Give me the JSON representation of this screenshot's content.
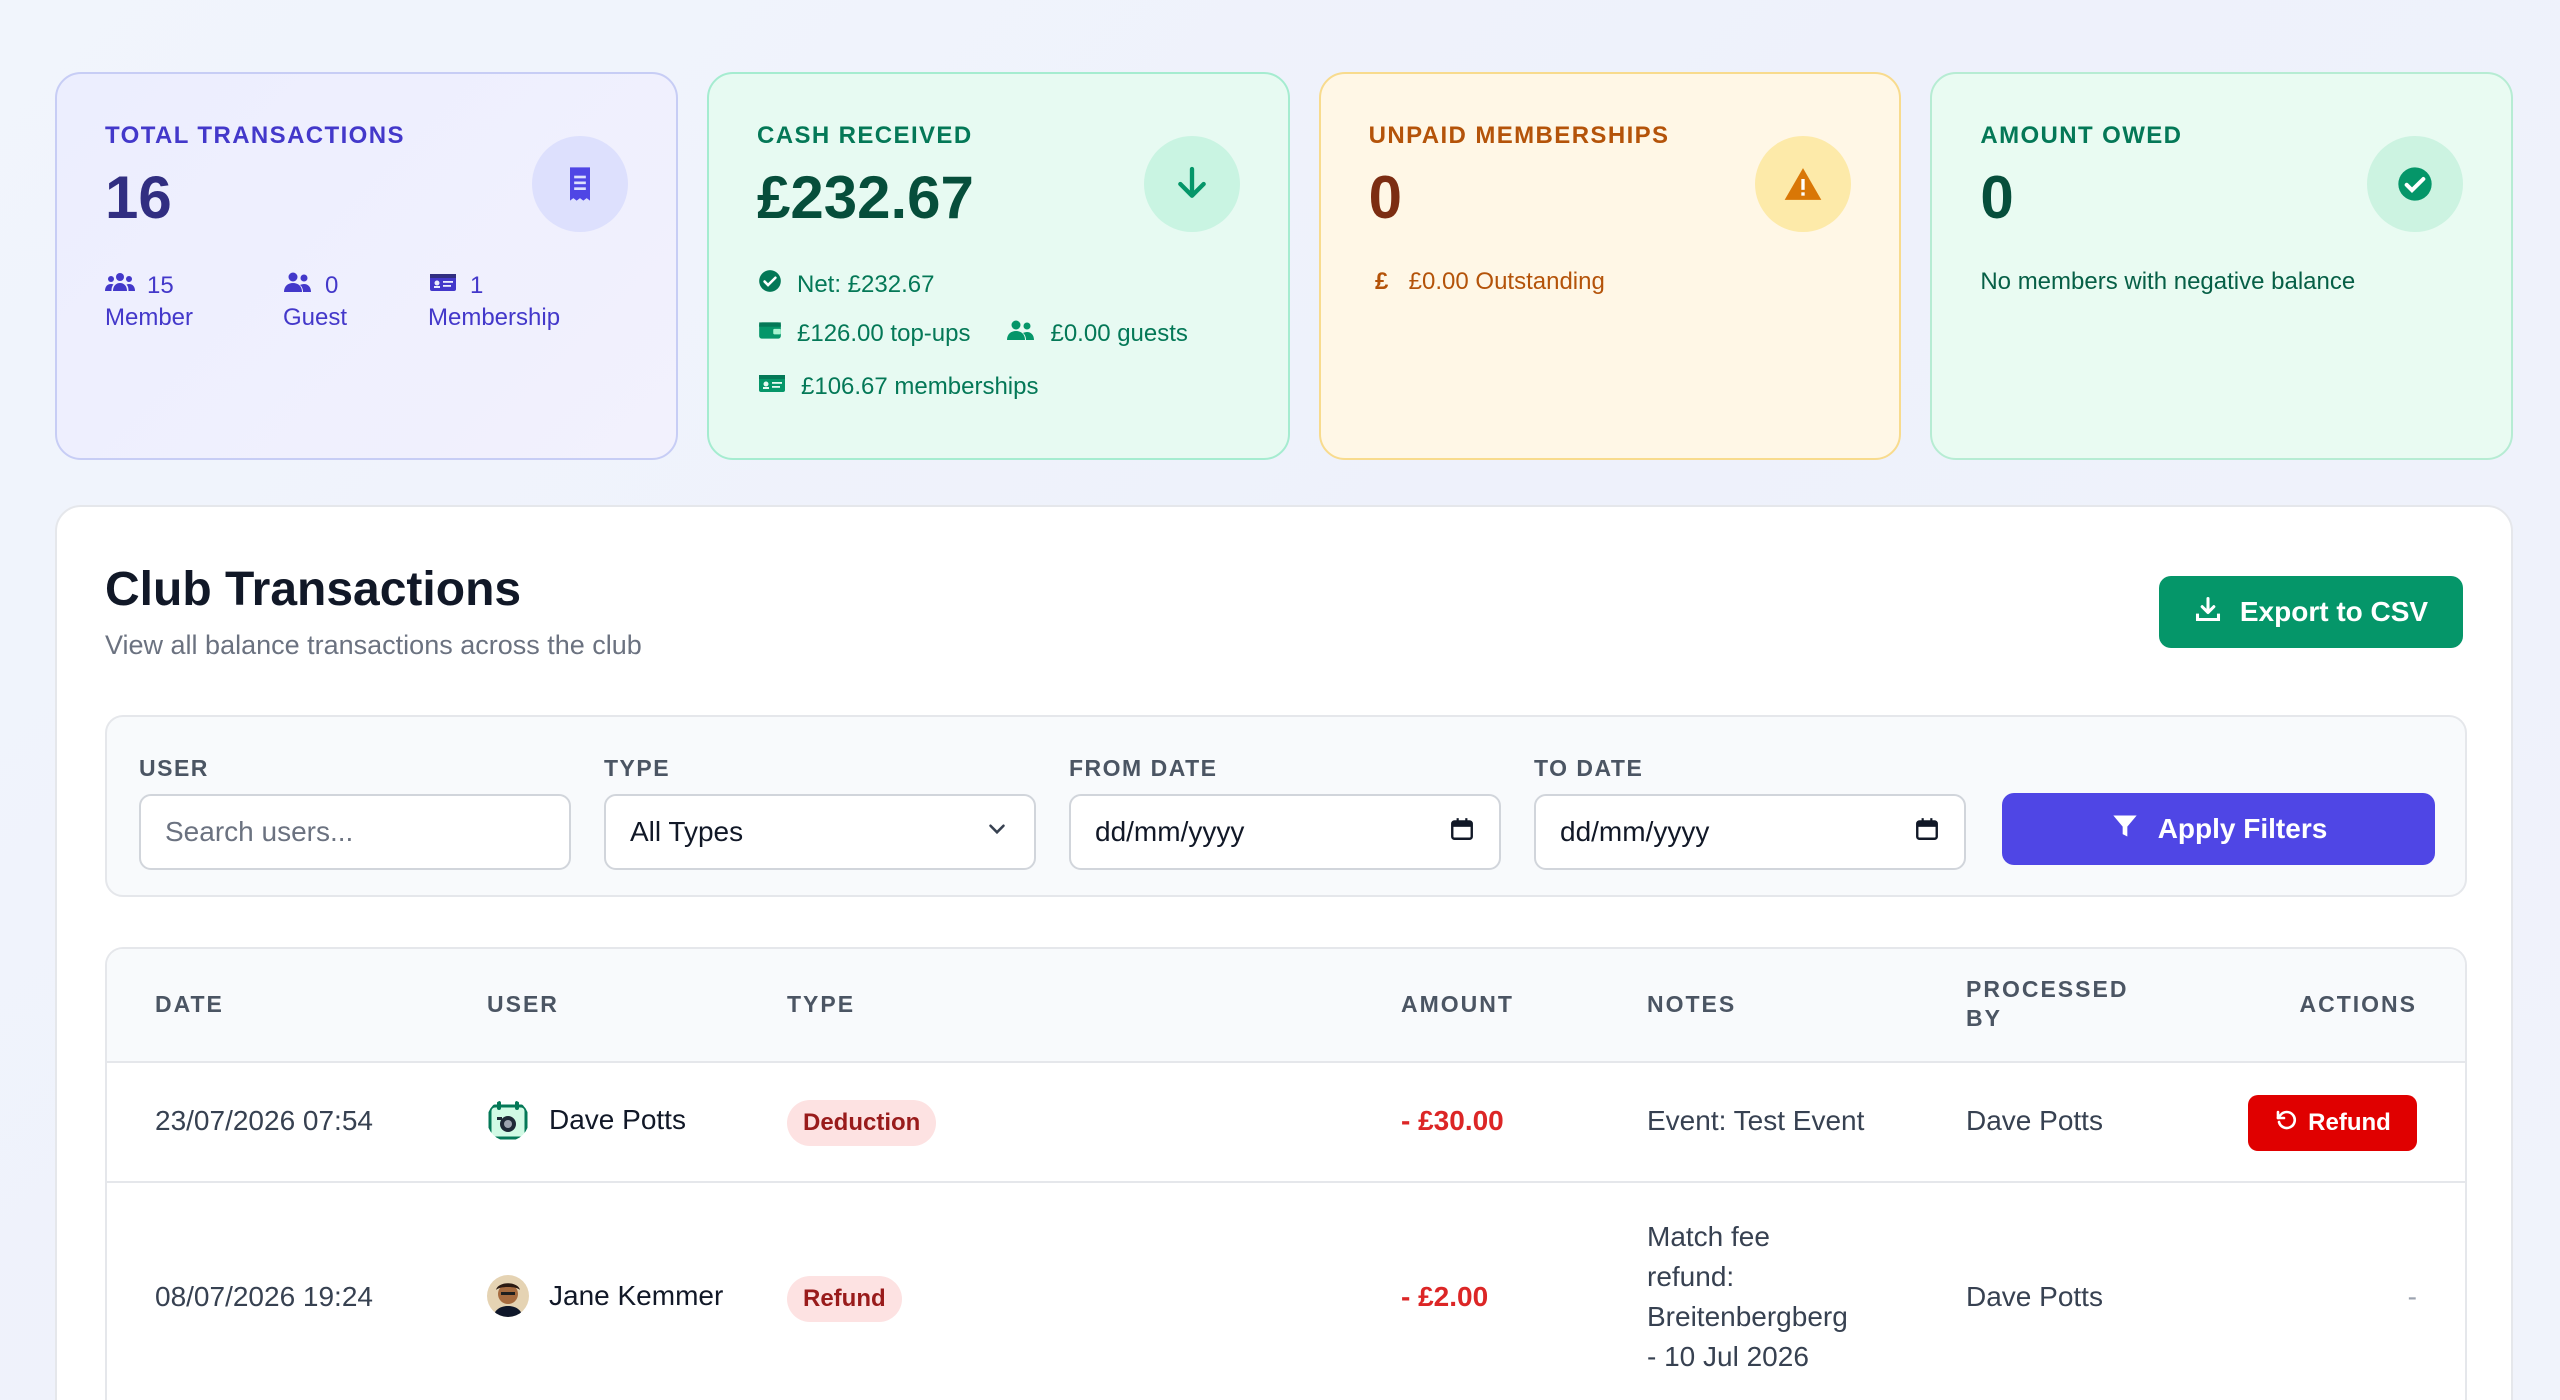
{
  "stats": {
    "total": {
      "label": "TOTAL TRANSACTIONS",
      "value": "16",
      "icon": "receipt-icon",
      "breakdown": [
        {
          "count": "15",
          "label": "Member",
          "icon": "users-icon"
        },
        {
          "count": "0",
          "label": "Guest",
          "icon": "user-group-icon"
        },
        {
          "count": "1",
          "label": "Membership",
          "icon": "id-card-icon"
        }
      ]
    },
    "cash": {
      "label": "CASH RECEIVED",
      "value": "£232.67",
      "icon": "arrow-down-icon",
      "net": "Net: £232.67",
      "topups": "£126.00 top-ups",
      "guests": "£0.00 guests",
      "memberships": "£106.67 memberships"
    },
    "unpaid": {
      "label": "UNPAID MEMBERSHIPS",
      "value": "0",
      "icon": "warning-icon",
      "currency_symbol": "£",
      "outstanding": "£0.00 Outstanding"
    },
    "owed": {
      "label": "AMOUNT OWED",
      "value": "0",
      "icon": "check-circle-icon",
      "note": "No members with negative balance"
    }
  },
  "panel": {
    "title": "Club Transactions",
    "subtitle": "View all balance transactions across the club",
    "export_label": "Export to CSV"
  },
  "filters": {
    "user_label": "USER",
    "user_placeholder": "Search users...",
    "type_label": "TYPE",
    "type_value": "All Types",
    "from_label": "FROM DATE",
    "from_value": "dd/mm/yyyy",
    "to_label": "TO DATE",
    "to_value": "dd/mm/yyyy",
    "apply_label": "Apply Filters"
  },
  "table": {
    "headers": {
      "date": "DATE",
      "user": "USER",
      "type": "TYPE",
      "amount": "AMOUNT",
      "notes": "NOTES",
      "processed_1": "PROCESSED",
      "processed_2": "BY",
      "actions": "ACTIONS"
    },
    "rows": [
      {
        "date": "23/07/2026 07:54",
        "user": "Dave Potts",
        "type": "Deduction",
        "amount": "- £30.00",
        "notes": "Event: Test Event",
        "processed_by": "Dave Potts",
        "action": "Refund"
      },
      {
        "date": "08/07/2026 19:24",
        "user": "Jane Kemmer",
        "type": "Refund",
        "amount": "- £2.00",
        "notes_lines": [
          "Match fee",
          "refund:",
          "Breitenbergberg",
          "- 10 Jul 2026"
        ],
        "processed_by": "Dave Potts",
        "action": "-"
      }
    ]
  },
  "colors": {
    "primary": "#4f46e5",
    "success": "#059669",
    "danger": "#e00000",
    "negative_amount": "#dc2626"
  }
}
